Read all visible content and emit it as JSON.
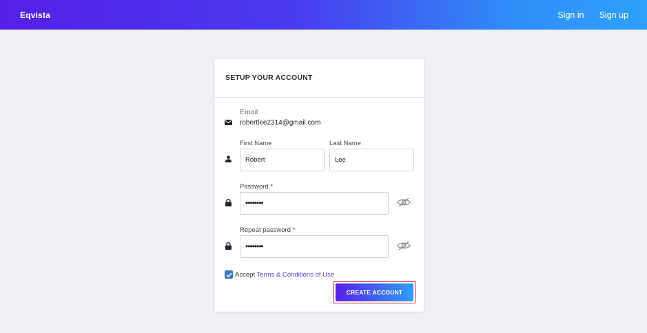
{
  "topbar": {
    "brand": "Eqvista",
    "nav": {
      "signin": "Sign in",
      "signup": "Sign up"
    }
  },
  "card": {
    "title": "SETUP YOUR ACCOUNT",
    "email": {
      "label": "Email",
      "value": "robertlee2314@gmail.com",
      "icon": "envelope-icon"
    },
    "first_name": {
      "label": "First Name",
      "value": "Robert"
    },
    "last_name": {
      "label": "Last Name",
      "value": "Lee"
    },
    "person_icon": "person-icon",
    "password": {
      "label": "Password *",
      "masked_value": "••••••••",
      "icon": "lock-icon",
      "toggle_icon": "eye-slash-icon"
    },
    "repeat_password": {
      "label": "Repeat password *",
      "masked_value": "••••••••",
      "icon": "lock-icon",
      "toggle_icon": "eye-slash-icon"
    },
    "terms": {
      "checked": true,
      "prefix": "Accept",
      "link_text": "Terms & Conditions of Use"
    },
    "submit_label": "CREATE ACCOUNT"
  },
  "colors": {
    "gradient_start": "#5520e6",
    "gradient_end": "#2fa0fb",
    "link": "#5a3be0",
    "checkbox": "#3a78b7",
    "highlight_border": "#d0202a"
  }
}
